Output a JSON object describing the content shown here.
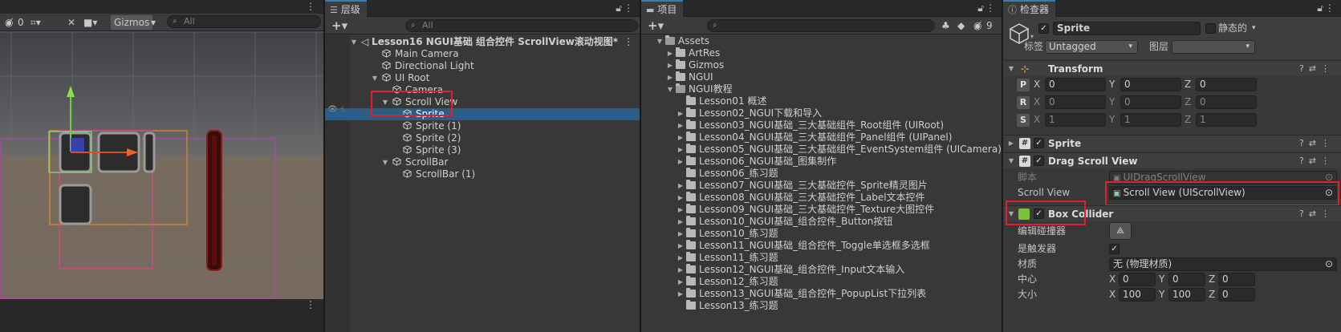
{
  "scene": {
    "toolbar": {
      "hidden_count": "0",
      "gizmos_label": "Gizmos",
      "search_placeholder": "All"
    },
    "colors": {
      "sky": "#4a4c52",
      "ground": "#7a6e63"
    }
  },
  "hierarchy": {
    "tab_label": "层级",
    "search_placeholder": "All",
    "rows": [
      {
        "label": "Lesson16 NGUI基础 组合控件 ScrollView滚动视图*",
        "indent": 0,
        "arrow": "open",
        "icon": "unity-scene-icon",
        "bold": true
      },
      {
        "label": "Main Camera",
        "indent": 1,
        "arrow": "",
        "icon": "cube-icon"
      },
      {
        "label": "Directional Light",
        "indent": 1,
        "arrow": "",
        "icon": "cube-icon"
      },
      {
        "label": "UI Root",
        "indent": 1,
        "arrow": "open",
        "icon": "cube-icon"
      },
      {
        "label": "Camera",
        "indent": 2,
        "arrow": "",
        "icon": "cube-icon"
      },
      {
        "label": "Scroll View",
        "indent": 2,
        "arrow": "open",
        "icon": "cube-icon"
      },
      {
        "label": "Sprite",
        "indent": 3,
        "arrow": "",
        "icon": "cube-icon",
        "selected": true
      },
      {
        "label": "Sprite (1)",
        "indent": 3,
        "arrow": "",
        "icon": "cube-icon"
      },
      {
        "label": "Sprite (2)",
        "indent": 3,
        "arrow": "",
        "icon": "cube-icon"
      },
      {
        "label": "Sprite (3)",
        "indent": 3,
        "arrow": "",
        "icon": "cube-icon"
      },
      {
        "label": "ScrollBar",
        "indent": 2,
        "arrow": "open",
        "icon": "cube-icon"
      },
      {
        "label": "ScrollBar (1)",
        "indent": 3,
        "arrow": "",
        "icon": "cube-icon"
      }
    ]
  },
  "project": {
    "tab_label": "项目",
    "hidden_count": "9",
    "rows": [
      {
        "label": "Assets",
        "indent": 0,
        "arrow": "open",
        "folder_open": true
      },
      {
        "label": "ArtRes",
        "indent": 1,
        "arrow": "closed"
      },
      {
        "label": "Gizmos",
        "indent": 1,
        "arrow": "closed"
      },
      {
        "label": "NGUI",
        "indent": 1,
        "arrow": "closed"
      },
      {
        "label": "NGUI教程",
        "indent": 1,
        "arrow": "open",
        "folder_open": true
      },
      {
        "label": "Lesson01 概述",
        "indent": 2,
        "arrow": ""
      },
      {
        "label": "Lesson02_NGUI下载和导入",
        "indent": 2,
        "arrow": "closed"
      },
      {
        "label": "Lesson03_NGUI基础_三大基础组件_Root组件 (UIRoot)",
        "indent": 2,
        "arrow": "closed"
      },
      {
        "label": "Lesson04_NGUI基础_三大基础组件_Panel组件 (UIPanel)",
        "indent": 2,
        "arrow": "closed"
      },
      {
        "label": "Lesson05_NGUI基础_三大基础组件_EventSystem组件 (UICamera)",
        "indent": 2,
        "arrow": "closed"
      },
      {
        "label": "Lesson06_NGUI基础_图集制作",
        "indent": 2,
        "arrow": "closed"
      },
      {
        "label": "Lesson06_练习题",
        "indent": 2,
        "arrow": ""
      },
      {
        "label": "Lesson07_NGUI基础_三大基础控件_Sprite精灵图片",
        "indent": 2,
        "arrow": "closed"
      },
      {
        "label": "Lesson08_NGUI基础_三大基础控件_Label文本控件",
        "indent": 2,
        "arrow": "closed"
      },
      {
        "label": "Lesson09_NGUI基础_三大基础控件_Texture大图控件",
        "indent": 2,
        "arrow": "closed"
      },
      {
        "label": "Lesson10_NGUI基础_组合控件_Button按钮",
        "indent": 2,
        "arrow": "closed"
      },
      {
        "label": "Lesson10_练习题",
        "indent": 2,
        "arrow": "closed"
      },
      {
        "label": "Lesson11_NGUI基础_组合控件_Toggle单选框多选框",
        "indent": 2,
        "arrow": "closed"
      },
      {
        "label": "Lesson11_练习题",
        "indent": 2,
        "arrow": "closed"
      },
      {
        "label": "Lesson12_NGUI基础_组合控件_Input文本输入",
        "indent": 2,
        "arrow": "closed"
      },
      {
        "label": "Lesson12_练习题",
        "indent": 2,
        "arrow": "closed"
      },
      {
        "label": "Lesson13_NGUI基础_组合控件_PopupList下拉列表",
        "indent": 2,
        "arrow": "closed"
      },
      {
        "label": "Lesson13_练习题",
        "indent": 2,
        "arrow": ""
      }
    ]
  },
  "inspector": {
    "tab_label": "检查器",
    "object_name": "Sprite",
    "static_label": "静态的",
    "tag_label": "标签",
    "tag_value": "Untagged",
    "layer_label": "图层",
    "layer_value": "",
    "transform": {
      "title": "Transform",
      "position": {
        "btn": "P",
        "x": "0",
        "y": "0",
        "z": "0"
      },
      "rotation": {
        "btn": "R",
        "x": "0",
        "y": "0",
        "z": "0"
      },
      "scale": {
        "btn": "S",
        "x": "1",
        "y": "1",
        "z": "1"
      }
    },
    "sprite_title": "Sprite",
    "drag_scroll_view": {
      "title": "Drag Scroll View",
      "script_label": "脚本",
      "script_value": "UIDragScrollView",
      "scroll_view_label": "Scroll View",
      "scroll_view_value": "Scroll View (UIScrollView)"
    },
    "box_collider": {
      "title": "Box Collider",
      "edit_label": "编辑碰撞器",
      "trigger_label": "是触发器",
      "material_label": "材质",
      "material_value": "无 (物理材质)",
      "center_label": "中心",
      "center": {
        "x": "0",
        "y": "0",
        "z": "0"
      },
      "size_label": "大小",
      "size": {
        "x": "100",
        "y": "100",
        "z": "0"
      }
    },
    "axis": {
      "x": "X",
      "y": "Y",
      "z": "Z"
    }
  }
}
